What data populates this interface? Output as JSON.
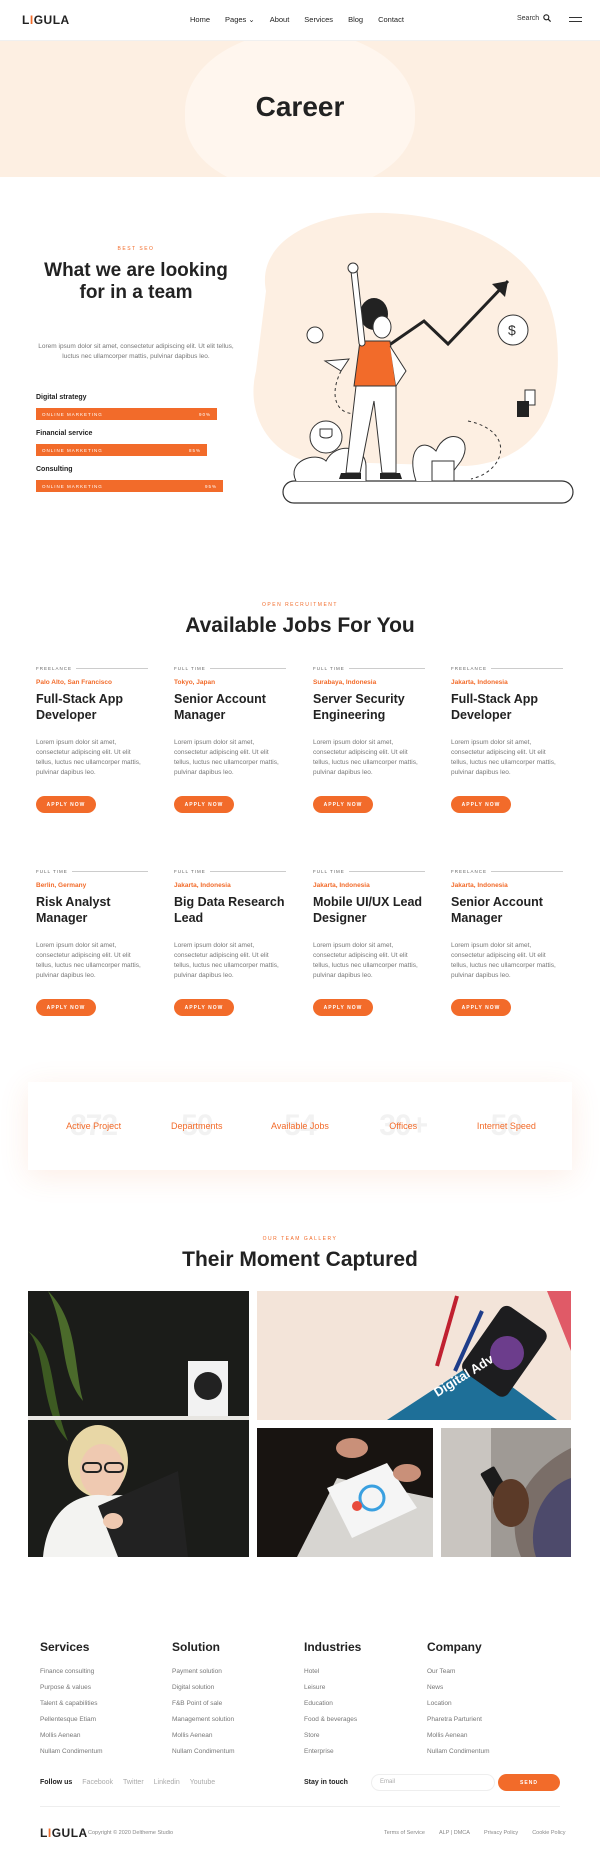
{
  "brand": {
    "logo": "LIGULA",
    "accent": "#f26b2a"
  },
  "nav": {
    "items": [
      "Home",
      "Pages",
      "About",
      "Services",
      "Blog",
      "Contact"
    ],
    "search": "Search"
  },
  "hero": {
    "title": "Career"
  },
  "intro": {
    "eyebrow": "BEST SEO",
    "title": "What we are looking for in a team",
    "text": "Lorem ipsum dolor sit amet, consectetur adipiscing elit. Ut elit tellus, luctus nec ullamcorper mattis, pulvinar dapibus leo.",
    "skills": [
      {
        "name": "Digital strategy",
        "bar": "ONLINE MARKETING",
        "pct": "90%",
        "value": 0.9
      },
      {
        "name": "Financial service",
        "bar": "ONLINE MARKETING",
        "pct": "85%",
        "value": 0.85
      },
      {
        "name": "Consulting",
        "bar": "ONLINE MARKETING",
        "pct": "95%",
        "value": 0.95
      }
    ]
  },
  "jobs": {
    "eyebrow": "OPEN RECRUITMENT",
    "title": "Available Jobs For You",
    "apply": "APPLY NOW",
    "desc": "Lorem ipsum dolor sit amet, consectetur adipiscing elit. Ut elit tellus, luctus nec ullamcorper mattis, pulvinar dapibus leo.",
    "items": [
      {
        "type": "FREELANCE",
        "location": "Palo Alto, San Francisco",
        "title": "Full-Stack App Developer"
      },
      {
        "type": "FULL TIME",
        "location": "Tokyo, Japan",
        "title": "Senior Account Manager"
      },
      {
        "type": "FULL TIME",
        "location": "Surabaya, Indonesia",
        "title": "Server Security Engineering"
      },
      {
        "type": "FREELANCE",
        "location": "Jakarta, Indonesia",
        "title": "Full-Stack App Developer"
      },
      {
        "type": "FULL TIME",
        "location": "Berlin, Germany",
        "title": "Risk Analyst Manager"
      },
      {
        "type": "FULL TIME",
        "location": "Jakarta, Indonesia",
        "title": "Big Data Research Lead"
      },
      {
        "type": "FULL TIME",
        "location": "Jakarta, Indonesia",
        "title": "Mobile UI/UX Lead Designer"
      },
      {
        "type": "FREELANCE",
        "location": "Jakarta, Indonesia",
        "title": "Senior Account Manager"
      }
    ]
  },
  "stats": [
    {
      "num": "872",
      "label": "Active Project"
    },
    {
      "num": "50",
      "label": "Departments"
    },
    {
      "num": "54",
      "label": "Available Jobs"
    },
    {
      "num": "30+",
      "label": "Offices"
    },
    {
      "num": "50",
      "label": "Internet Speed"
    }
  ],
  "gallery": {
    "eyebrow": "OUR TEAM GALLERY",
    "title": "Their Moment Captured",
    "book_text": "Digital Adv"
  },
  "footer": {
    "columns": [
      {
        "title": "Services",
        "links": [
          "Finance consulting",
          "Purpose & values",
          "Talent & capabilities",
          "Pellentesque Etiam",
          "Mollis Aenean",
          "Nullam Condimentum"
        ]
      },
      {
        "title": "Solution",
        "links": [
          "Payment solution",
          "Digital solution",
          "F&B Point of sale",
          "Management solution",
          "Mollis Aenean",
          "Nullam Condimentum"
        ]
      },
      {
        "title": "Industries",
        "links": [
          "Hotel",
          "Leisure",
          "Education",
          "Food & beverages",
          "Store",
          "Enterprise"
        ]
      },
      {
        "title": "Company",
        "links": [
          "Our Team",
          "News",
          "Location",
          "Pharetra Parturient",
          "Mollis Aenean",
          "Nullam Condimentum"
        ]
      }
    ],
    "follow": "Follow us",
    "social": [
      "Facebook",
      "Twitter",
      "Linkedin",
      "Youtube"
    ],
    "stay": "Stay in touch",
    "email_placeholder": "Email",
    "send": "SEND",
    "logo": "LIGULA",
    "copyright": "Copyright © 2020 Deltheme Studio",
    "legal": [
      "Terms of Service",
      "ALP | DMCA",
      "Privacy Policy",
      "Cookie Policy"
    ]
  }
}
